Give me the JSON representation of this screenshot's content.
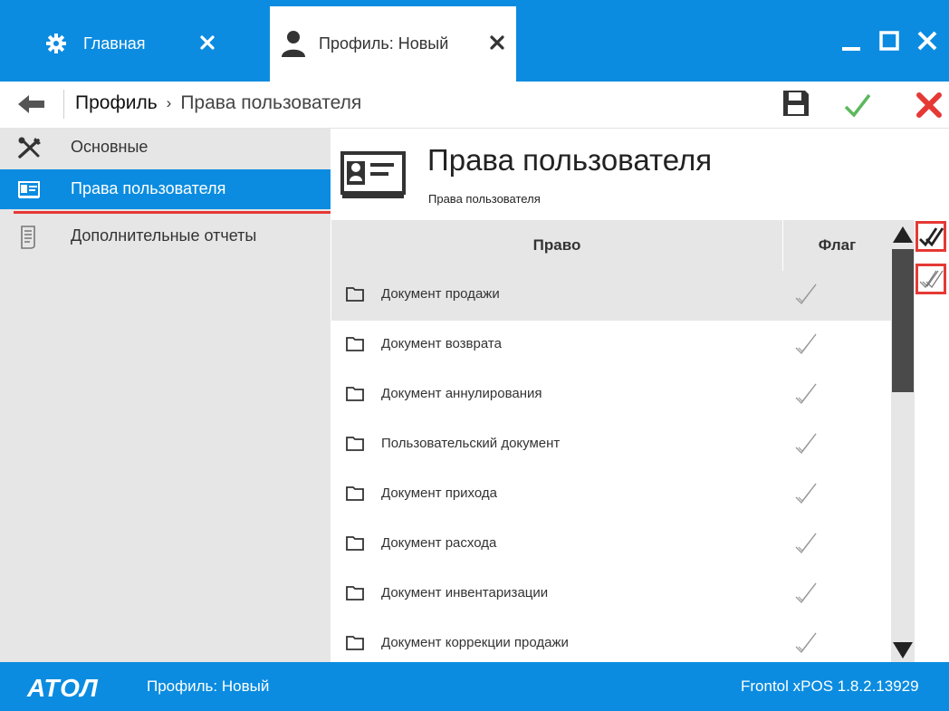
{
  "tabs": [
    {
      "label": "Главная",
      "icon": "gear-icon"
    },
    {
      "label": "Профиль: Новый",
      "icon": "user-icon"
    }
  ],
  "window_controls": {
    "minimize_icon": "minimize-icon",
    "maximize_icon": "maximize-icon",
    "close_icon": "close-icon"
  },
  "breadcrumb": {
    "parent": "Профиль",
    "separator": "›",
    "current": "Права пользователя"
  },
  "toolbar": {
    "save_icon": "save-icon",
    "ok_icon": "checkmark-icon",
    "cancel_icon": "cancel-icon"
  },
  "sidebar": {
    "items": [
      {
        "label": "Основные",
        "icon": "tools-icon",
        "active": false
      },
      {
        "label": "Права пользователя",
        "icon": "id-card-icon",
        "active": true
      },
      {
        "label": "Дополнительные отчеты",
        "icon": "report-icon",
        "active": false
      }
    ]
  },
  "content": {
    "title": "Права пользователя",
    "subtitle": "Права пользователя"
  },
  "grid": {
    "columns": [
      "Право",
      "Флаг"
    ],
    "rows": [
      {
        "label": "Документ продажи",
        "flag": true
      },
      {
        "label": "Документ возврата",
        "flag": true
      },
      {
        "label": "Документ аннулирования",
        "flag": true
      },
      {
        "label": "Пользовательский документ",
        "flag": true
      },
      {
        "label": "Документ прихода",
        "flag": true
      },
      {
        "label": "Документ расхода",
        "flag": true
      },
      {
        "label": "Документ инвентаризации",
        "flag": true
      },
      {
        "label": "Документ коррекции продажи",
        "flag": true
      }
    ]
  },
  "side_actions": {
    "check_all_icon": "check-all-icon",
    "uncheck_all_icon": "uncheck-all-icon"
  },
  "statusbar": {
    "brand": "АТОЛ",
    "profile": "Профиль: Новый",
    "version": "Frontol xPOS 1.8.2.13929"
  },
  "colors": {
    "accent": "#0b8ce0",
    "highlight": "#e53935",
    "panel": "#e6e6e6",
    "ok": "#5cb85c",
    "cancel": "#e53935"
  }
}
